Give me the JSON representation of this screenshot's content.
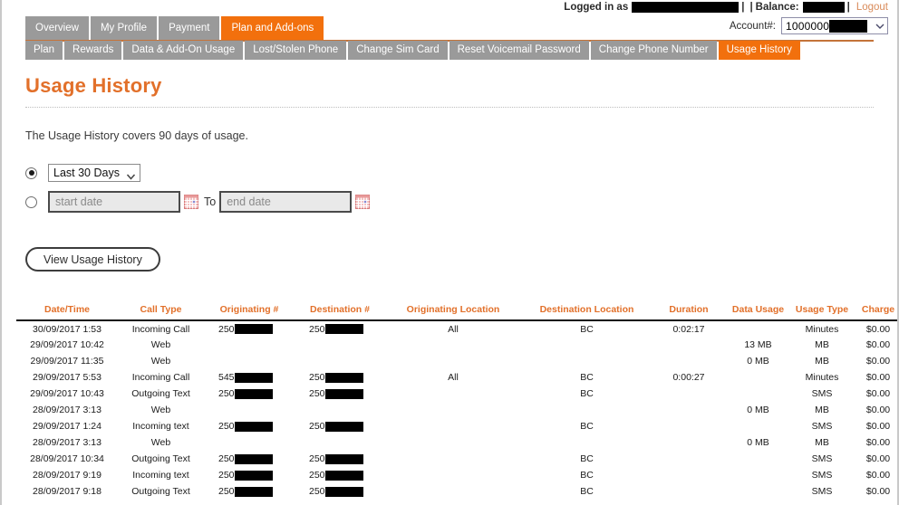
{
  "header": {
    "logged_in_label": "Logged in as",
    "logged_in_value": "",
    "separator": "|",
    "balance_label": "Balance:",
    "balance_value": "",
    "logout_label": "Logout",
    "account_label": "Account#:",
    "account_value": "1000000"
  },
  "primary_tabs": [
    {
      "label": "Overview",
      "active": false
    },
    {
      "label": "My Profile",
      "active": false
    },
    {
      "label": "Payment",
      "active": false
    },
    {
      "label": "Plan and Add-ons",
      "active": true
    }
  ],
  "secondary_tabs": [
    {
      "label": "Plan",
      "active": false
    },
    {
      "label": "Rewards",
      "active": false
    },
    {
      "label": "Data & Add-On Usage",
      "active": false
    },
    {
      "label": "Lost/Stolen Phone",
      "active": false
    },
    {
      "label": "Change Sim Card",
      "active": false
    },
    {
      "label": "Reset Voicemail Password",
      "active": false
    },
    {
      "label": "Change Phone Number",
      "active": false
    },
    {
      "label": "Usage History",
      "active": true
    }
  ],
  "main": {
    "page_title": "Usage History",
    "intro_text": "The Usage History covers 90 days of usage.",
    "range_select_value": "Last 30 Days",
    "start_date_placeholder": "start date",
    "end_date_placeholder": "end date",
    "to_label": "To",
    "view_button_label": "View Usage History"
  },
  "table": {
    "columns": [
      "Date/Time",
      "Call Type",
      "Originating #",
      "Destination #",
      "Originating Location",
      "Destination Location",
      "Duration",
      "Data Usage",
      "Usage Type",
      "Charge"
    ],
    "rows": [
      {
        "datetime": "30/09/2017 1:53",
        "call_type": "Incoming Call",
        "originating_prefix": "250",
        "destination_prefix": "250",
        "originating_location": "All",
        "destination_location": "BC",
        "duration": "0:02:17",
        "data_usage": "",
        "usage_type": "Minutes",
        "charge": "$0.00"
      },
      {
        "datetime": "29/09/2017 10:42",
        "call_type": "Web",
        "originating_prefix": "",
        "destination_prefix": "",
        "originating_location": "",
        "destination_location": "",
        "duration": "",
        "data_usage": "13 MB",
        "usage_type": "MB",
        "charge": "$0.00"
      },
      {
        "datetime": "29/09/2017 11:35",
        "call_type": "Web",
        "originating_prefix": "",
        "destination_prefix": "",
        "originating_location": "",
        "destination_location": "",
        "duration": "",
        "data_usage": "0 MB",
        "usage_type": "MB",
        "charge": "$0.00"
      },
      {
        "datetime": "29/09/2017 5:53",
        "call_type": "Incoming Call",
        "originating_prefix": "545",
        "destination_prefix": "250",
        "originating_location": "All",
        "destination_location": "BC",
        "duration": "0:00:27",
        "data_usage": "",
        "usage_type": "Minutes",
        "charge": "$0.00"
      },
      {
        "datetime": "29/09/2017 10:43",
        "call_type": "Outgoing Text",
        "originating_prefix": "250",
        "destination_prefix": "250",
        "originating_location": "",
        "destination_location": "BC",
        "duration": "",
        "data_usage": "",
        "usage_type": "SMS",
        "charge": "$0.00"
      },
      {
        "datetime": "28/09/2017 3:13",
        "call_type": "Web",
        "originating_prefix": "",
        "destination_prefix": "",
        "originating_location": "",
        "destination_location": "",
        "duration": "",
        "data_usage": "0 MB",
        "usage_type": "MB",
        "charge": "$0.00"
      },
      {
        "datetime": "29/09/2017 1:24",
        "call_type": "Incoming text",
        "originating_prefix": "250",
        "destination_prefix": "250",
        "originating_location": "",
        "destination_location": "BC",
        "duration": "",
        "data_usage": "",
        "usage_type": "SMS",
        "charge": "$0.00"
      },
      {
        "datetime": "28/09/2017 3:13",
        "call_type": "Web",
        "originating_prefix": "",
        "destination_prefix": "",
        "originating_location": "",
        "destination_location": "",
        "duration": "",
        "data_usage": "0 MB",
        "usage_type": "MB",
        "charge": "$0.00"
      },
      {
        "datetime": "28/09/2017 10:34",
        "call_type": "Outgoing Text",
        "originating_prefix": "250",
        "destination_prefix": "250",
        "originating_location": "",
        "destination_location": "BC",
        "duration": "",
        "data_usage": "",
        "usage_type": "SMS",
        "charge": "$0.00"
      },
      {
        "datetime": "28/09/2017 9:19",
        "call_type": "Incoming text",
        "originating_prefix": "250",
        "destination_prefix": "250",
        "originating_location": "",
        "destination_location": "BC",
        "duration": "",
        "data_usage": "",
        "usage_type": "SMS",
        "charge": "$0.00"
      },
      {
        "datetime": "28/09/2017 9:18",
        "call_type": "Outgoing Text",
        "originating_prefix": "250",
        "destination_prefix": "250",
        "originating_location": "",
        "destination_location": "BC",
        "duration": "",
        "data_usage": "",
        "usage_type": "SMS",
        "charge": "$0.00"
      }
    ]
  },
  "colors": {
    "accent_orange": "#f2700d",
    "title_orange": "#e2702a",
    "tab_gray": "#9a9a9a",
    "rule_orange": "#c4743a"
  }
}
